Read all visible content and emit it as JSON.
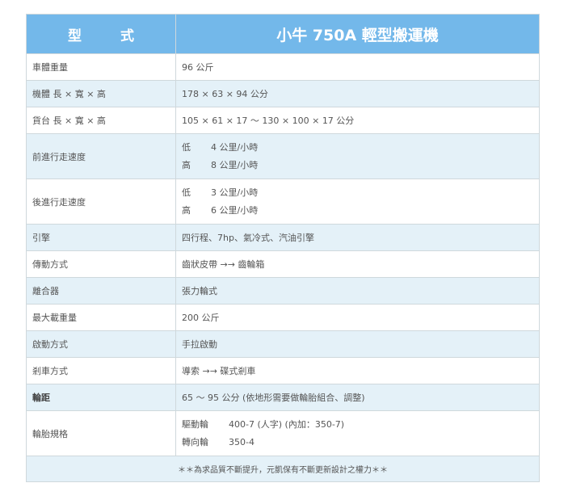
{
  "header": {
    "label_left": "型",
    "label_right": "式",
    "product": "小牛 750A 輕型搬運機"
  },
  "rows": [
    {
      "label": "車體重量",
      "value": "96 公斤"
    },
    {
      "label": "機體 長 × 寬 × 高",
      "value": "178 × 63 × 94 公分"
    },
    {
      "label": "貨台 長 × 寬 × 高",
      "value": "105 × 61 × 17 ～ 130 × 100 × 17 公分"
    },
    {
      "label": "前進行走速度",
      "lines": [
        {
          "level": "低",
          "value": "4  公里/小時"
        },
        {
          "level": "高",
          "value": "8  公里/小時"
        }
      ]
    },
    {
      "label": "後進行走速度",
      "lines": [
        {
          "level": "低",
          "value": "3  公里/小時"
        },
        {
          "level": "高",
          "value": "6  公里/小時"
        }
      ]
    },
    {
      "label": "引擎",
      "value": "四行程、7hp、氣冷式、汽油引擎"
    },
    {
      "label": "傳動方式",
      "value": "齒狀皮帶 →→ 齒輪箱"
    },
    {
      "label": "離合器",
      "value": "張力輪式"
    },
    {
      "label": "最大載重量",
      "value": "200 公斤"
    },
    {
      "label": "啟動方式",
      "value": "手拉啟動"
    },
    {
      "label": "剎車方式",
      "value": "導索 →→ 碟式剎車"
    },
    {
      "label": "輪距",
      "value": "65 ～ 95 公分 (依地形需要做輪胎組合、調整)"
    },
    {
      "label": "輪胎規格",
      "lines": [
        {
          "level": "驅動輪",
          "value": "400-7 (人字) (內加：350-7)"
        },
        {
          "level": "轉向輪",
          "value": "350-4"
        }
      ]
    }
  ],
  "footer": "＊＊為求品質不斷提升，元凱保有不斷更新設計之權力＊＊"
}
